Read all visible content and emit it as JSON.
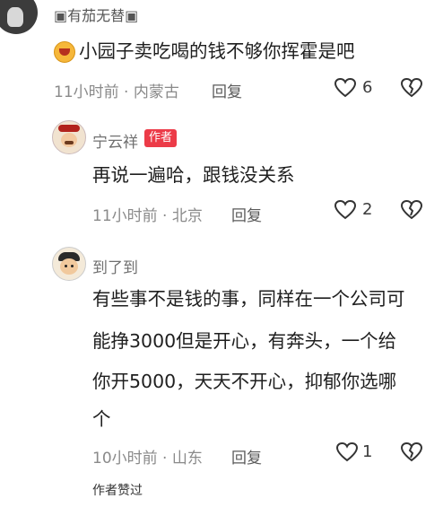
{
  "comments": [
    {
      "username": "▣有茄无替▣",
      "text": "小园子卖吃喝的钱不够你挥霍是吧",
      "time_location": "11小时前 · 内蒙古",
      "reply_label": "回复",
      "like_count": "6"
    },
    {
      "username": "宁云祥",
      "badge": "作者",
      "text": "再说一遍哈，跟钱没关系",
      "time_location": "11小时前 · 北京",
      "reply_label": "回复",
      "like_count": "2"
    },
    {
      "username": "到了到",
      "text_lines": [
        "有些事不是钱的事，同样在一个公司可",
        "能挣3000但是开心，有奔头，一个给",
        "你开5000，天天不开心，抑郁你选哪",
        "个"
      ],
      "time_location": "10小时前 · 山东",
      "reply_label": "回复",
      "like_count": "1",
      "author_liked": "作者赞过"
    }
  ],
  "icons": {
    "like": "heart-outline-icon",
    "dislike": "broken-heart-icon"
  },
  "colors": {
    "badge_bg": "#ec3b48",
    "meta_text": "#8a8a8a"
  }
}
